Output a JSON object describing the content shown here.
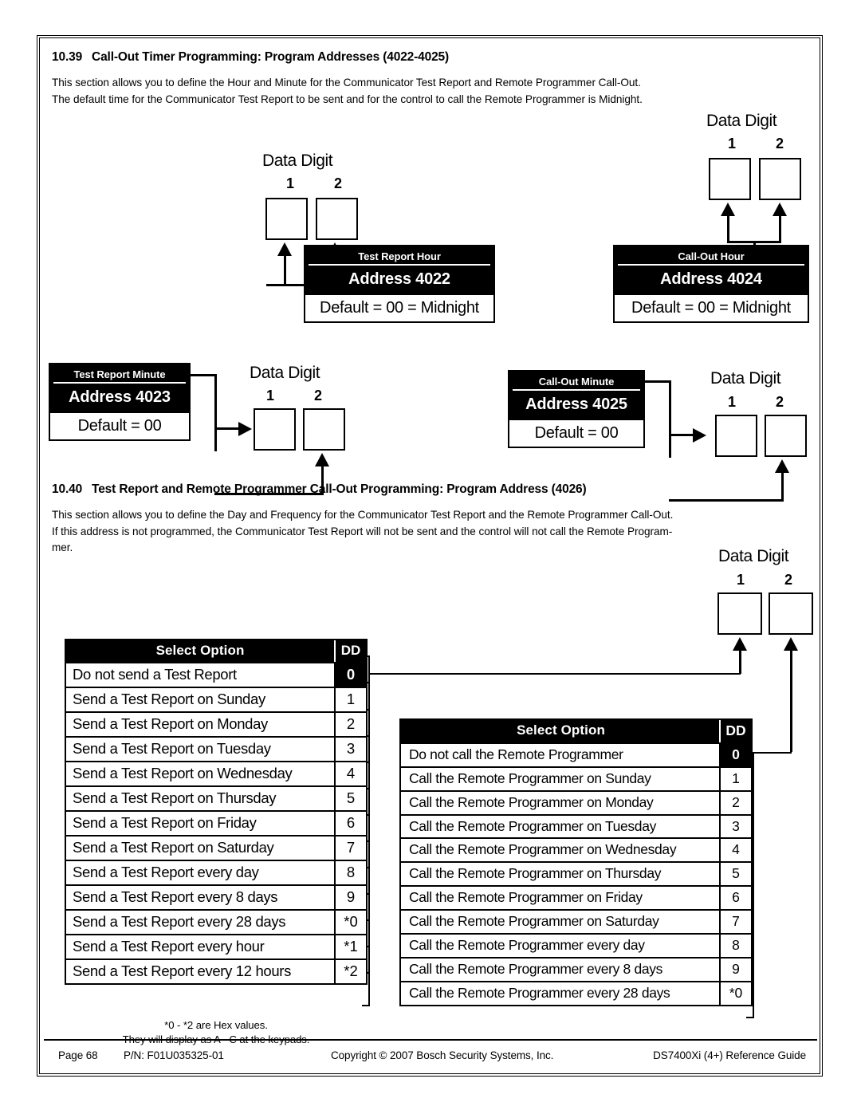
{
  "section_1": {
    "number": "10.39",
    "title": "Call-Out Timer Programming: Program Addresses (4022-4025)",
    "paragraph_line_1": "This section allows you to define the Hour and Minute for the Communicator Test Report and Remote Programmer Call-Out.",
    "paragraph_line_2": "The default time for the Communicator Test Report to be sent and for the control to call the Remote Programmer is Midnight."
  },
  "section_2": {
    "number": "10.40",
    "title": "Test Report and Remote Programmer Call-Out Programming: Program Address (4026)",
    "paragraph_line_1": "This section allows you to define the Day and Frequency for the Communicator Test Report and the Remote Programmer Call-Out.",
    "paragraph_line_2": "If this address is not programmed, the Communicator Test Report will not be sent and the control will not call the Remote Program-",
    "paragraph_line_3": "mer."
  },
  "data_digit": {
    "caption": "Data Digit",
    "index_1": "1",
    "index_2": "2"
  },
  "address_blocks": [
    {
      "id": "test-report-hour",
      "title": "Test Report Hour",
      "address": "Address 4022",
      "default": "Default = 00 = Midnight"
    },
    {
      "id": "call-out-hour",
      "title": "Call-Out Hour",
      "address": "Address 4024",
      "default": "Default = 00 = Midnight"
    },
    {
      "id": "test-report-minute",
      "title": "Test Report Minute",
      "address": "Address 4023",
      "default": "Default = 00"
    },
    {
      "id": "call-out-minute",
      "title": "Call-Out Minute",
      "address": "Address 4025",
      "default": "Default = 00"
    }
  ],
  "option_table_1": {
    "header_label": "Select Option",
    "header_dd": "DD",
    "rows": [
      {
        "label": "Do not send a Test Report",
        "dd": "0"
      },
      {
        "label": "Send a Test Report on Sunday",
        "dd": "1"
      },
      {
        "label": "Send a Test Report on Monday",
        "dd": "2"
      },
      {
        "label": "Send a Test Report on Tuesday",
        "dd": "3"
      },
      {
        "label": "Send a Test Report on Wednesday",
        "dd": "4"
      },
      {
        "label": "Send a Test Report on Thursday",
        "dd": "5"
      },
      {
        "label": "Send a Test Report on Friday",
        "dd": "6"
      },
      {
        "label": "Send a Test Report on Saturday",
        "dd": "7"
      },
      {
        "label": "Send a Test Report every day",
        "dd": "8"
      },
      {
        "label": "Send a Test Report every 8 days",
        "dd": "9"
      },
      {
        "label": "Send a Test Report every 28 days",
        "dd": "*0"
      },
      {
        "label": "Send a Test Report every hour",
        "dd": "*1"
      },
      {
        "label": "Send a Test Report every 12 hours",
        "dd": "*2"
      }
    ]
  },
  "option_table_2": {
    "header_label": "Select Option",
    "header_dd": "DD",
    "rows": [
      {
        "label": "Do not call the Remote Programmer",
        "dd": "0"
      },
      {
        "label": "Call the Remote Programmer on Sunday",
        "dd": "1"
      },
      {
        "label": "Call the Remote Programmer on Monday",
        "dd": "2"
      },
      {
        "label": "Call the Remote Programmer on Tuesday",
        "dd": "3"
      },
      {
        "label": "Call the Remote Programmer on Wednesday",
        "dd": "4"
      },
      {
        "label": "Call the Remote Programmer on Thursday",
        "dd": "5"
      },
      {
        "label": "Call the Remote Programmer on Friday",
        "dd": "6"
      },
      {
        "label": "Call the Remote Programmer on Saturday",
        "dd": "7"
      },
      {
        "label": "Call the Remote Programmer every day",
        "dd": "8"
      },
      {
        "label": "Call the Remote Programmer every 8 days",
        "dd": "9"
      },
      {
        "label": "Call the Remote Programmer every 28 days",
        "dd": "*0"
      }
    ]
  },
  "footnote": {
    "line_1": "*0 - *2 are Hex values.",
    "line_2": "They will display as A - C at the keypads."
  },
  "footer": {
    "page": "Page 68",
    "part_number": "P/N: F01U035325-01",
    "copyright": "Copyright © 2007 Bosch Security Systems, Inc.",
    "guide": "DS7400Xi (4+) Reference Guide"
  }
}
